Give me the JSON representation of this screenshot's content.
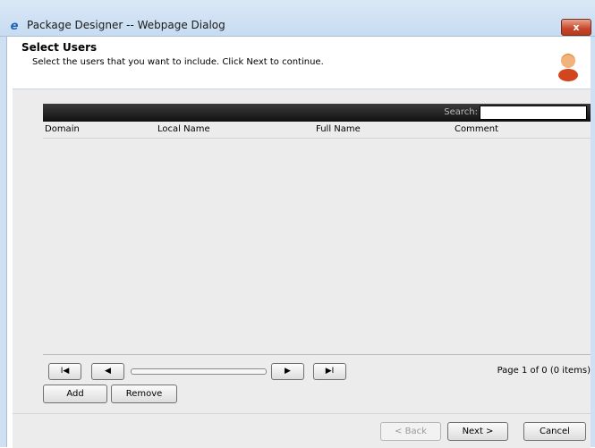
{
  "window": {
    "title": "Package Designer -- Webpage Dialog",
    "close_label": "x"
  },
  "header": {
    "title": "Select Users",
    "subtitle": "Select the users that you want to include. Click Next to continue."
  },
  "grid": {
    "search_label": "Search:",
    "search_value": "",
    "columns": [
      "Domain",
      "Local Name",
      "Full Name",
      "Comment"
    ],
    "rows": []
  },
  "pager": {
    "first_label": "I◀",
    "prev_label": "◀",
    "next_label": "▶",
    "last_label": "▶I",
    "page_info": "Page 1 of 0 (0 items)"
  },
  "actions": {
    "add_label": "Add",
    "remove_label": "Remove"
  },
  "footer": {
    "back_label": "< Back",
    "next_label": "Next >",
    "cancel_label": "Cancel"
  }
}
